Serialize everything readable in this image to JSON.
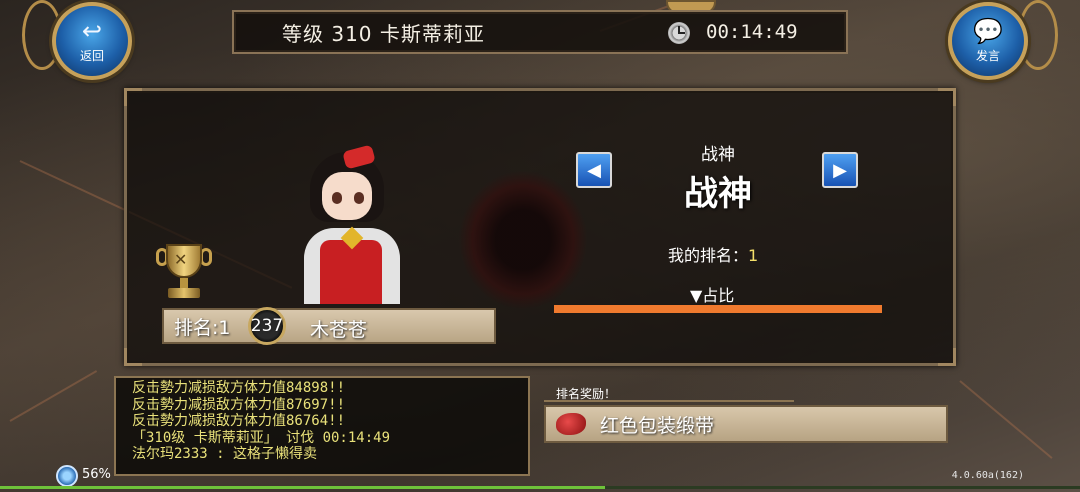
{
  "header": {
    "title": "等级 310 卡斯蒂莉亚",
    "timer": "00:14:49"
  },
  "buttons": {
    "back_label": "返回",
    "chat_label": "发言"
  },
  "ranking": {
    "rank_text": "排名:1",
    "level": "237",
    "player_name": "木苍苍",
    "category_small": "战神",
    "category_big": "战神",
    "my_rank_label": "我的排名：",
    "my_rank_value": "1",
    "share_label": "▼占比",
    "share_fraction": 1.0
  },
  "chat": {
    "lines": [
      "反击勢力减损敌方体力值84898!!",
      "反击勢力减损敌方体力值87697!!",
      "反击勢力减损敌方体力值86764!!",
      "「310级 卡斯蒂莉亚」 讨伐 00:14:49",
      "法尔玛2333       : 这格子懒得卖"
    ]
  },
  "reward": {
    "title": "排名奖励！",
    "item_name": "红色包装缎带"
  },
  "status": {
    "battery": "56%",
    "version": "4.0.60a(162)",
    "load_fraction": 0.56
  },
  "colors": {
    "accent_gold": "#c6a15a",
    "share_bar": "#f07a2e",
    "chat_text": "#e9e17a"
  }
}
